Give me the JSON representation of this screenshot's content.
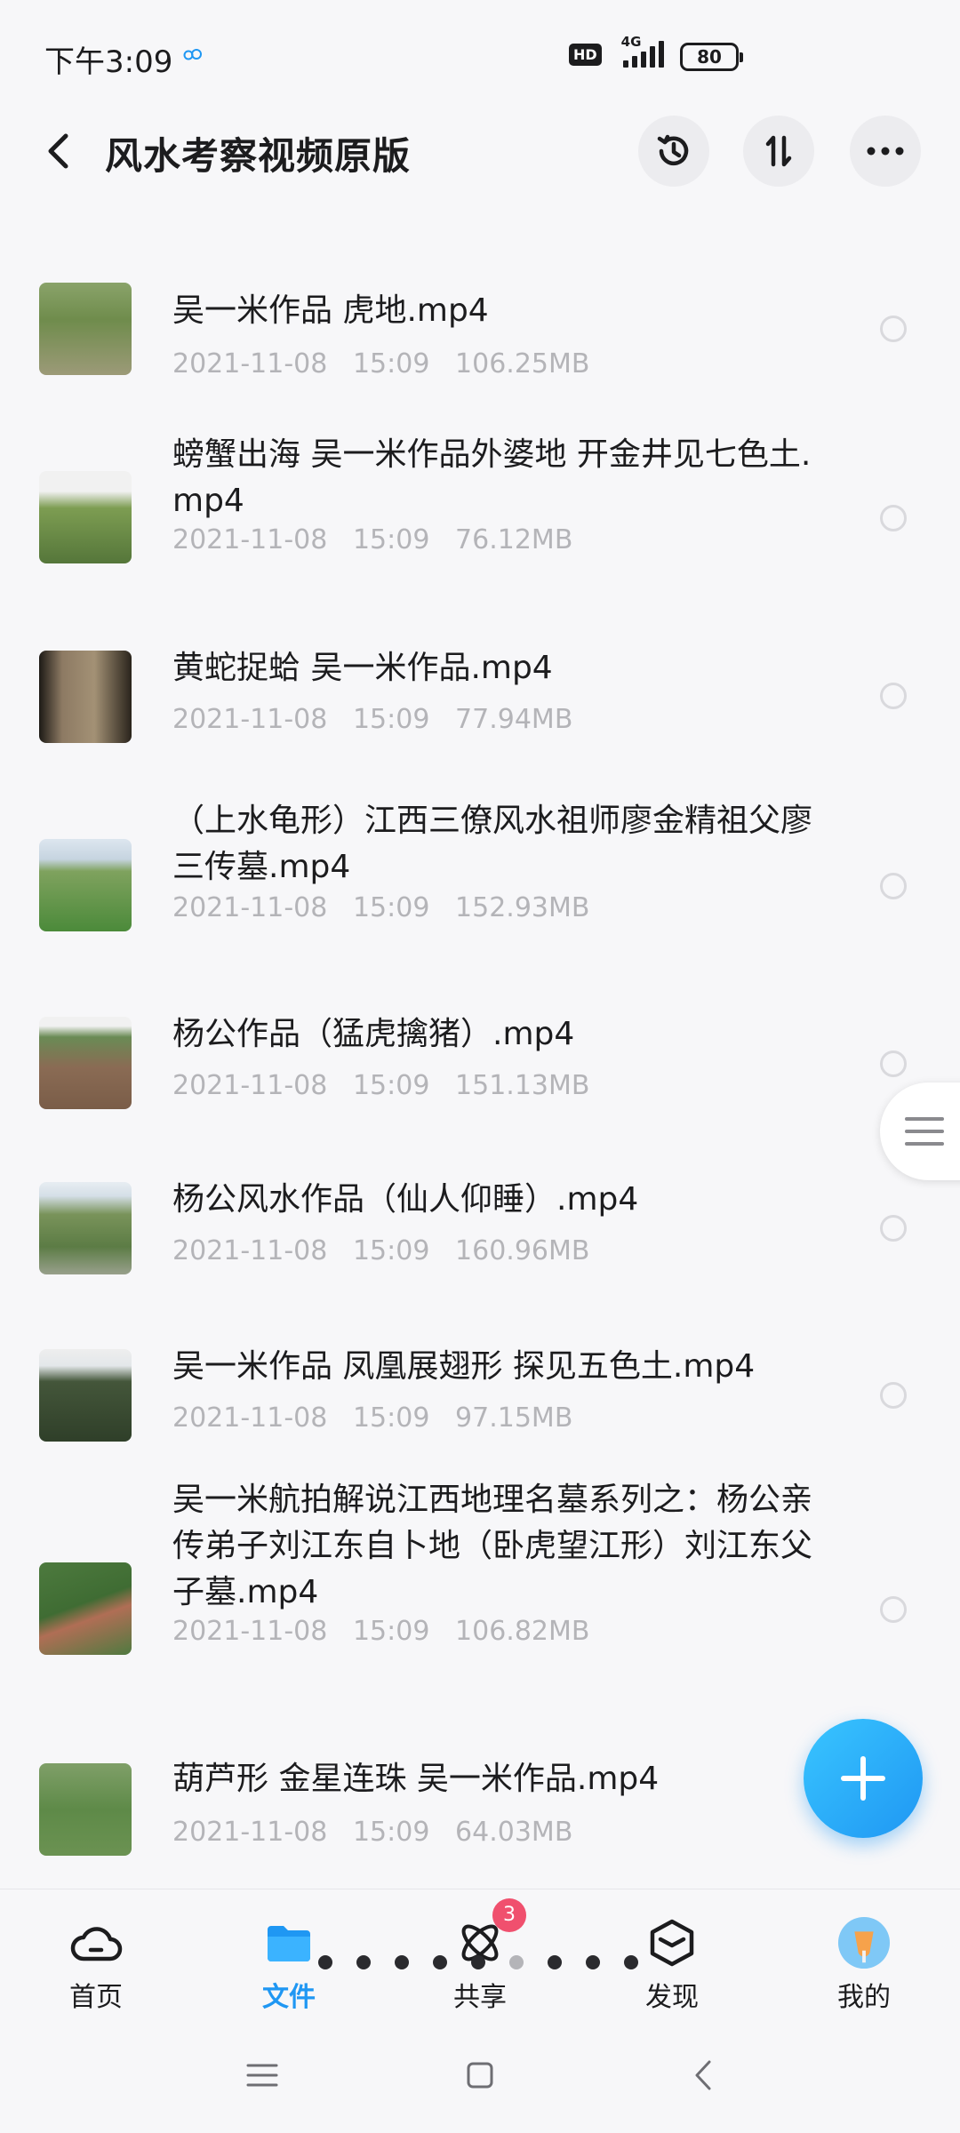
{
  "status_bar": {
    "time": "下午3:09",
    "hd": "HD",
    "network": "4G",
    "battery": "80"
  },
  "header": {
    "title": "风水考察视频原版",
    "back_icon": "chevron-left-icon",
    "history_icon": "history-icon",
    "sort_icon": "sort-icon",
    "more_icon": "more-icon"
  },
  "files": [
    {
      "name": "吴一米作品 虎地.mp4",
      "date": "2021-11-08",
      "time": "15:09",
      "size": "106.25MB"
    },
    {
      "name": "螃蟹出海 吴一米作品外婆地 开金井见七色土.mp4",
      "date": "2021-11-08",
      "time": "15:09",
      "size": "76.12MB"
    },
    {
      "name": "黄蛇捉蛤 吴一米作品.mp4",
      "date": "2021-11-08",
      "time": "15:09",
      "size": "77.94MB"
    },
    {
      "name": "（上水龟形）江西三僚风水祖师廖金精祖父廖三传墓.mp4",
      "date": "2021-11-08",
      "time": "15:09",
      "size": "152.93MB"
    },
    {
      "name": "杨公作品（猛虎擒猪）.mp4",
      "date": "2021-11-08",
      "time": "15:09",
      "size": "151.13MB"
    },
    {
      "name": "杨公风水作品（仙人仰睡）.mp4",
      "date": "2021-11-08",
      "time": "15:09",
      "size": "160.96MB"
    },
    {
      "name": "吴一米作品 凤凰展翅形 探见五色土.mp4",
      "date": "2021-11-08",
      "time": "15:09",
      "size": "97.15MB"
    },
    {
      "name": "吴一米航拍解说江西地理名墓系列之：杨公亲传弟子刘江东自卜地（卧虎望江形）刘江东父子墓.mp4",
      "date": "2021-11-08",
      "time": "15:09",
      "size": "106.82MB"
    },
    {
      "name": "葫芦形 金星连珠 吴一米作品.mp4",
      "date": "2021-11-08",
      "time": "15:09",
      "size": "64.03MB"
    }
  ],
  "fab": {
    "icon": "plus-icon"
  },
  "bottom_nav": {
    "items": [
      {
        "label": "首页",
        "icon": "cloud-icon"
      },
      {
        "label": "文件",
        "icon": "folder-icon"
      },
      {
        "label": "共享",
        "icon": "share-atom-icon",
        "badge": "3"
      },
      {
        "label": "发现",
        "icon": "discover-cube-icon"
      },
      {
        "label": "我的",
        "icon": "avatar"
      }
    ],
    "active_index": 1
  },
  "colors": {
    "accent": "#1f97f3",
    "badge": "#f0506e",
    "meta_text": "#b4b4b8"
  }
}
